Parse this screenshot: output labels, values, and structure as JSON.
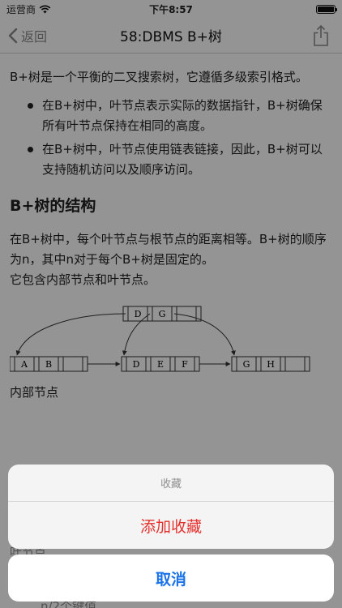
{
  "status_bar": {
    "carrier": "运营商",
    "time": "下午8:57",
    "battery_level": 1.0
  },
  "nav": {
    "back_label": "返回",
    "title": "58:DBMS B+树"
  },
  "content": {
    "intro": "B+树是一个平衡的二叉搜索树，它遵循多级索引格式。",
    "bullets": [
      "在B+树中，叶节点表示实际的数据指针，B+树确保所有叶节点保持在相同的高度。",
      "在B+树中，叶节点使用链表链接，因此，B+树可以支持随机访问以及顺序访问。"
    ],
    "heading": "B+树的结构",
    "para1": "在B+树中，每个叶节点与根节点的距离相等。B+树的顺序为n，其中n对于每个B+树是固定的。",
    "para2": "它包含内部节点和叶节点。",
    "diagram": {
      "root_keys": [
        "D",
        "G"
      ],
      "leaf_keys": [
        "A",
        "B",
        "D",
        "E",
        "F",
        "G",
        "H"
      ]
    },
    "caption_internal": "内部节点",
    "caption_leaf_partial": "叶节点",
    "bottom_partial": "n/2个键值"
  },
  "action_sheet": {
    "title": "收藏",
    "action_label": "添加收藏",
    "cancel_label": "取消",
    "colors": {
      "action": "#e5312e",
      "cancel": "#1a73e8"
    }
  }
}
